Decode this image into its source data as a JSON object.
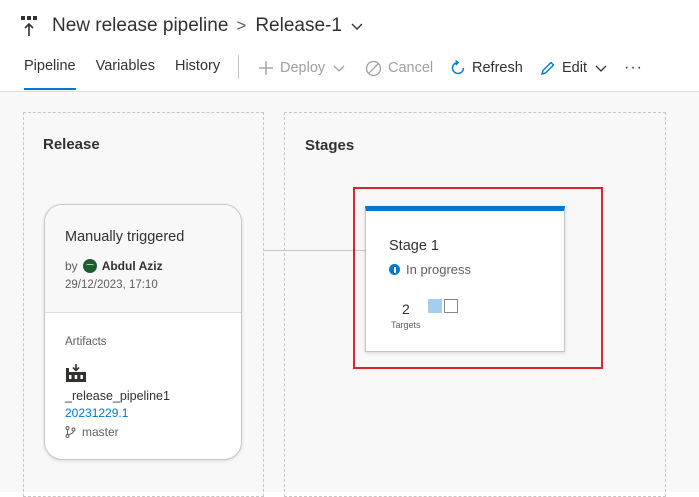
{
  "header": {
    "pipeline_name": "New release pipeline",
    "separator": ">",
    "release_name": "Release-1"
  },
  "tabs": [
    {
      "label": "Pipeline",
      "active": true
    },
    {
      "label": "Variables",
      "active": false
    },
    {
      "label": "History",
      "active": false
    }
  ],
  "toolbar": {
    "deploy_label": "Deploy",
    "cancel_label": "Cancel",
    "refresh_label": "Refresh",
    "edit_label": "Edit",
    "more_label": "···"
  },
  "release_panel": {
    "title": "Release",
    "trigger": "Manually triggered",
    "by_label": "by",
    "user": "Abdul Aziz",
    "datetime": "29/12/2023, 17:10",
    "artifacts_label": "Artifacts",
    "artifact": {
      "name": "_release_pipeline1",
      "version": "20231229.1",
      "branch": "master"
    }
  },
  "stages_panel": {
    "title": "Stages",
    "stages": [
      {
        "name": "Stage 1",
        "status": "In progress",
        "target_count": "2",
        "targets_label": "Targets"
      }
    ]
  },
  "colors": {
    "accent": "#0078d4",
    "highlight": "#d9262d",
    "target_done": "#a6cdea"
  }
}
